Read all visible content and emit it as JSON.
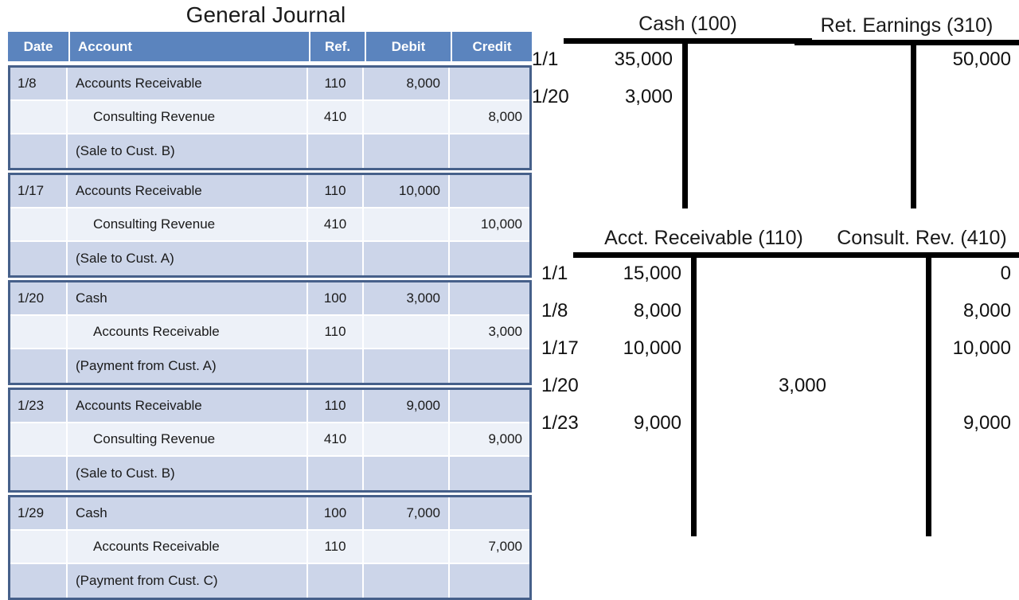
{
  "journal": {
    "title": "General Journal",
    "columns": {
      "date": "Date",
      "account": "Account",
      "ref": "Ref.",
      "debit": "Debit",
      "credit": "Credit"
    },
    "entries": [
      {
        "rows": [
          {
            "date": "1/8",
            "account": "Accounts Receivable",
            "indent": false,
            "ref": "110",
            "debit": "8,000",
            "credit": ""
          },
          {
            "date": "",
            "account": "Consulting Revenue",
            "indent": true,
            "ref": "410",
            "debit": "",
            "credit": "8,000"
          },
          {
            "date": "",
            "account": "(Sale to Cust. B)",
            "indent": false,
            "ref": "",
            "debit": "",
            "credit": ""
          }
        ]
      },
      {
        "rows": [
          {
            "date": "1/17",
            "account": "Accounts Receivable",
            "indent": false,
            "ref": "110",
            "debit": "10,000",
            "credit": ""
          },
          {
            "date": "",
            "account": "Consulting Revenue",
            "indent": true,
            "ref": "410",
            "debit": "",
            "credit": "10,000"
          },
          {
            "date": "",
            "account": "(Sale to Cust. A)",
            "indent": false,
            "ref": "",
            "debit": "",
            "credit": ""
          }
        ]
      },
      {
        "rows": [
          {
            "date": "1/20",
            "account": "Cash",
            "indent": false,
            "ref": "100",
            "debit": "3,000",
            "credit": ""
          },
          {
            "date": "",
            "account": "Accounts Receivable",
            "indent": true,
            "ref": "110",
            "debit": "",
            "credit": "3,000"
          },
          {
            "date": "",
            "account": "(Payment from Cust. A)",
            "indent": false,
            "ref": "",
            "debit": "",
            "credit": ""
          }
        ]
      },
      {
        "rows": [
          {
            "date": "1/23",
            "account": "Accounts Receivable",
            "indent": false,
            "ref": "110",
            "debit": "9,000",
            "credit": ""
          },
          {
            "date": "",
            "account": "Consulting Revenue",
            "indent": true,
            "ref": "410",
            "debit": "",
            "credit": "9,000"
          },
          {
            "date": "",
            "account": "(Sale to Cust. B)",
            "indent": false,
            "ref": "",
            "debit": "",
            "credit": ""
          }
        ]
      },
      {
        "rows": [
          {
            "date": "1/29",
            "account": "Cash",
            "indent": false,
            "ref": "100",
            "debit": "7,000",
            "credit": ""
          },
          {
            "date": "",
            "account": "Accounts Receivable",
            "indent": true,
            "ref": "110",
            "debit": "",
            "credit": "7,000"
          },
          {
            "date": "",
            "account": "(Payment from Cust. C)",
            "indent": false,
            "ref": "",
            "debit": "",
            "credit": ""
          }
        ]
      }
    ]
  },
  "t_accounts": [
    {
      "id": "cash",
      "title": "Cash (100)",
      "rows": [
        {
          "date": "1/1",
          "debit": "35,000",
          "credit": ""
        },
        {
          "date": "1/20",
          "debit": "3,000",
          "credit": ""
        }
      ]
    },
    {
      "id": "retained-earnings",
      "title": "Ret. Earnings (310)",
      "rows": [
        {
          "date": "",
          "debit": "",
          "credit": "50,000"
        }
      ]
    },
    {
      "id": "accounts-receivable",
      "title": "Acct. Receivable (110)",
      "rows": [
        {
          "date": "1/1",
          "debit": "15,000",
          "credit": ""
        },
        {
          "date": "1/8",
          "debit": "8,000",
          "credit": ""
        },
        {
          "date": "1/17",
          "debit": "10,000",
          "credit": ""
        },
        {
          "date": "1/20",
          "debit": "",
          "credit": "3,000"
        },
        {
          "date": "1/23",
          "debit": "9,000",
          "credit": ""
        }
      ]
    },
    {
      "id": "consulting-revenue",
      "title": "Consult. Rev. (410)",
      "rows": [
        {
          "date": "",
          "debit": "",
          "credit": "0"
        },
        {
          "date": "",
          "debit": "",
          "credit": "8,000"
        },
        {
          "date": "",
          "debit": "",
          "credit": "10,000"
        },
        {
          "date": "",
          "debit": "",
          "credit": ""
        },
        {
          "date": "",
          "debit": "",
          "credit": "9,000"
        }
      ]
    }
  ],
  "colors": {
    "header_blue": "#5b84be",
    "block_border": "#46608a",
    "row_shade_dark": "#ccd5e9",
    "row_shade_light": "#edf1f8",
    "rule_black": "#000000"
  }
}
